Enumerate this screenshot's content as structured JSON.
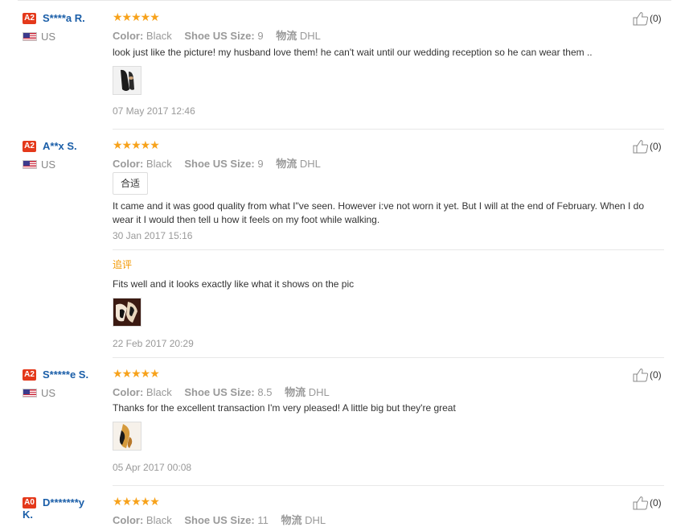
{
  "labels": {
    "color": "Color:",
    "size": "Shoe US Size:",
    "shipping": "物流"
  },
  "reviews": [
    {
      "badge": "A2",
      "name": "S****a R.",
      "country": "US",
      "stars": "★★★★★",
      "color": "Black",
      "size": "9",
      "shipping": "DHL",
      "text": "look just like the picture! my husband love them! he can't wait until our wedding reception so he can wear them ..",
      "date": "07 May 2017 12:46",
      "likes": "(0)"
    },
    {
      "badge": "A2",
      "name": "A**x S.",
      "country": "US",
      "stars": "★★★★★",
      "color": "Black",
      "size": "9",
      "shipping": "DHL",
      "tag": "合适",
      "text": "It came and it was good quality from what I\"ve seen. However i:ve not worn it yet. But I will at the end of February. When I do wear it I would then tell u how it feels on my foot while walking.",
      "date": "30 Jan 2017 15:16",
      "likes": "(0)",
      "followup_label": "追评",
      "followup_text": "Fits well and it looks exactly like what it shows on the pic",
      "followup_date": "22 Feb 2017 20:29"
    },
    {
      "badge": "A2",
      "name": "S*****e S.",
      "country": "US",
      "stars": "★★★★★",
      "color": "Black",
      "size": "8.5",
      "shipping": "DHL",
      "text": "Thanks for the excellent transaction I'm very pleased! A little big but they're great",
      "date": "05 Apr 2017 00:08",
      "likes": "(0)"
    },
    {
      "badge": "A0",
      "name": "D*******y K.",
      "stars": "★★★★★",
      "color": "Black",
      "size": "11",
      "shipping": "DHL",
      "likes": "(0)"
    }
  ],
  "icons": {
    "like": "thumbs-up-icon",
    "flag": "us-flag-icon",
    "star": "star-icon"
  },
  "colors": {
    "badge": "#e4391b",
    "name": "#1a5ea8",
    "star": "#f7a21b",
    "followup": "#f39800"
  }
}
